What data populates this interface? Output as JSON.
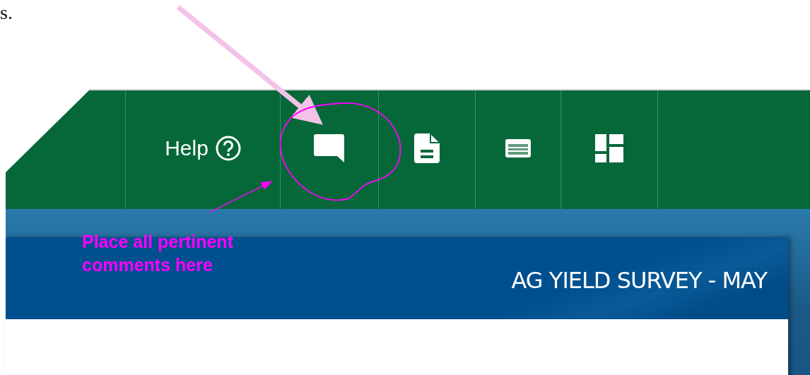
{
  "document_text": "s.",
  "toolbar": {
    "items": [
      {
        "kind": "help",
        "label": "Help"
      },
      {
        "kind": "comment"
      },
      {
        "kind": "document"
      },
      {
        "kind": "card"
      },
      {
        "kind": "dashboard"
      }
    ]
  },
  "survey": {
    "title": "AG YIELD SURVEY - MAY"
  },
  "annotation": {
    "note": "Place all pertinent comments here"
  }
}
